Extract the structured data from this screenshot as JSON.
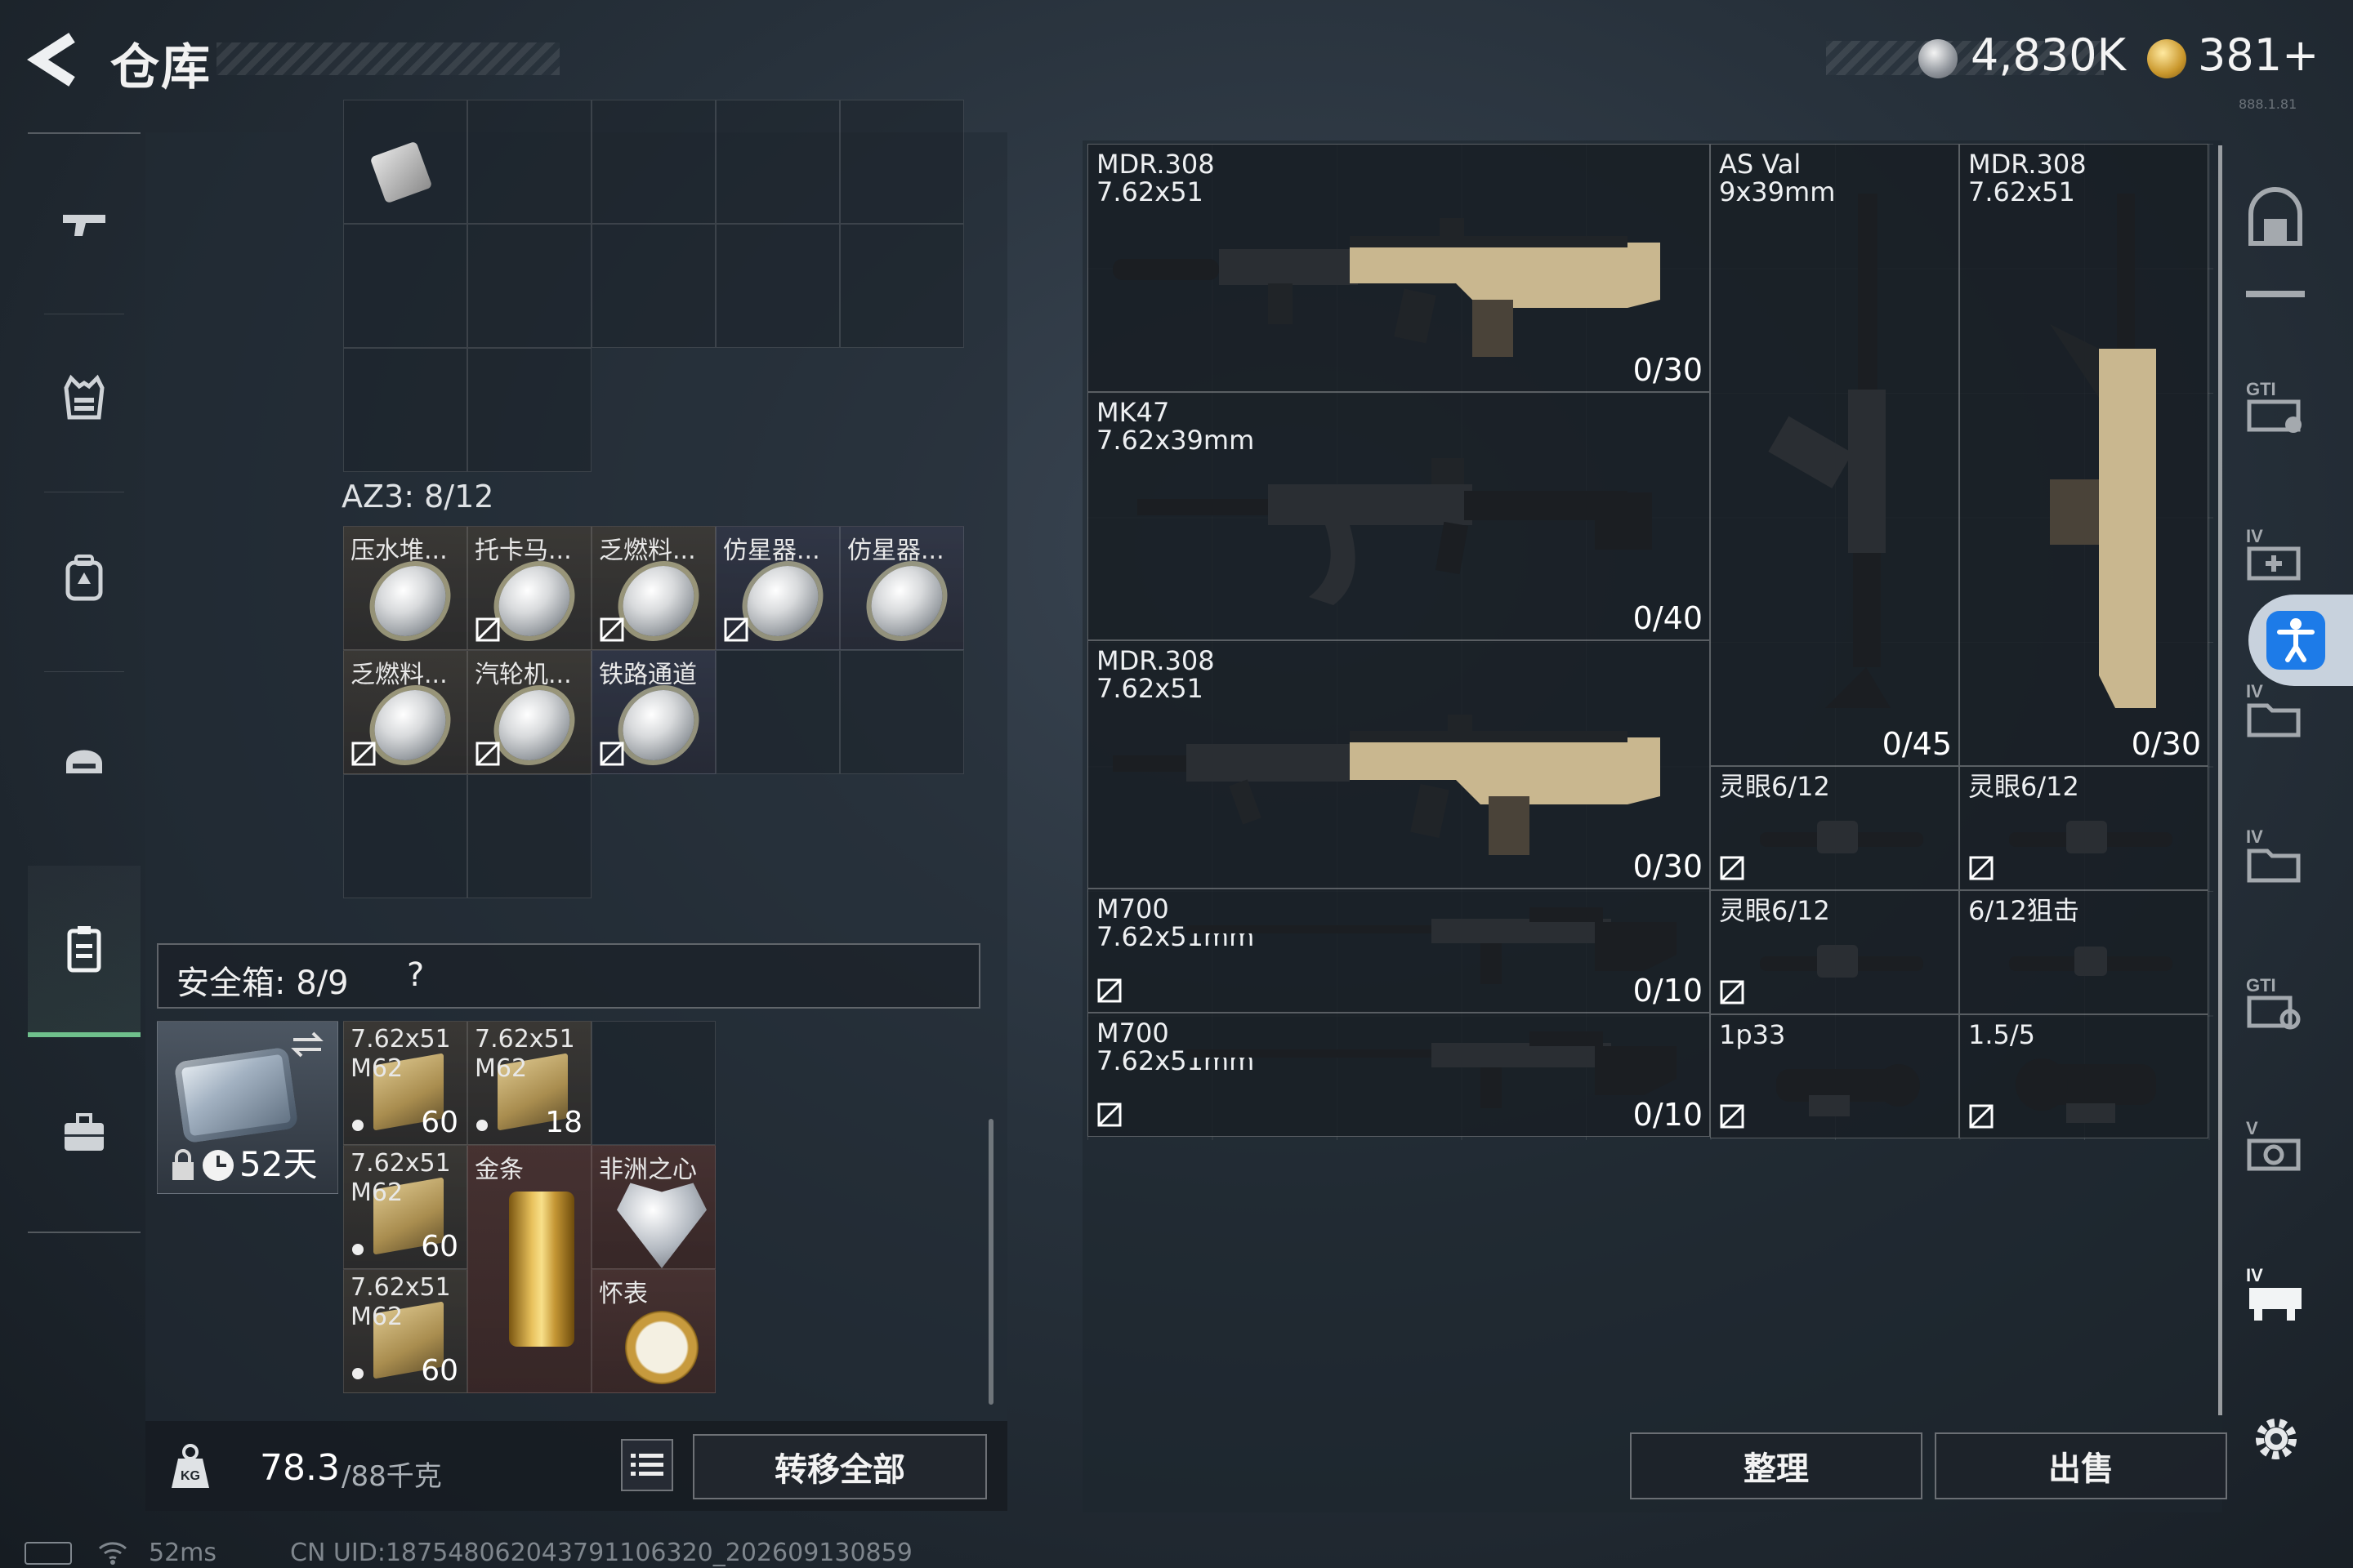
{
  "header": {
    "title": "仓库",
    "currency_silver": "4,830K",
    "currency_gold": "381+",
    "version_tag": "888.1.81"
  },
  "left_nav": {
    "items": [
      {
        "name": "weapons",
        "icon": "pistol-icon"
      },
      {
        "name": "armor",
        "icon": "vest-icon"
      },
      {
        "name": "backpack",
        "icon": "backpack-icon"
      },
      {
        "name": "helmet-gear",
        "icon": "helmet-icon"
      },
      {
        "name": "containers",
        "icon": "clipboard-icon"
      },
      {
        "name": "case",
        "icon": "briefcase-icon"
      }
    ],
    "active_index": 4
  },
  "stash": {
    "az3_label": "AZ3: 8/12",
    "az3_items": [
      {
        "name": "压水堆...",
        "no_sell": false
      },
      {
        "name": "托卡马...",
        "no_sell": true
      },
      {
        "name": "乏燃料...",
        "no_sell": true
      },
      {
        "name": "仿星器...",
        "no_sell": true
      },
      {
        "name": "仿星器...",
        "no_sell": false
      },
      {
        "name": "乏燃料...",
        "no_sell": true
      },
      {
        "name": "汽轮机...",
        "no_sell": true
      },
      {
        "name": "铁路通道",
        "no_sell": true
      }
    ],
    "safe_label": "安全箱: 8/9",
    "safe_help": "?",
    "case_days": "52天",
    "safe_items": [
      {
        "line1": "7.62x51",
        "line2": "M62",
        "count": "60"
      },
      {
        "line1": "7.62x51",
        "line2": "M62",
        "count": "18"
      },
      {
        "line1": "7.62x51",
        "line2": "M62",
        "count": "60"
      },
      {
        "line1": "金条",
        "line2": "",
        "count": ""
      },
      {
        "line1": "非洲之心",
        "line2": "",
        "count": ""
      },
      {
        "line1": "7.62x51",
        "line2": "M62",
        "count": "60"
      },
      {
        "line1": "怀表",
        "line2": "",
        "count": ""
      }
    ],
    "weight_current": "78.3",
    "weight_max": "/88千克",
    "transfer_all": "转移全部"
  },
  "weapons": [
    {
      "name": "MDR.308",
      "caliber": "7.62x51",
      "ammo": "0/30"
    },
    {
      "name": "AS Val",
      "caliber": "9x39mm",
      "ammo": "0/45"
    },
    {
      "name": "MDR.308",
      "caliber": "7.62x51",
      "ammo": "0/30"
    },
    {
      "name": "MK47",
      "caliber": "7.62x39mm",
      "ammo": "0/40"
    },
    {
      "name": "MDR.308",
      "caliber": "7.62x51",
      "ammo": "0/30"
    },
    {
      "name": "M700",
      "caliber": "7.62x51mm",
      "ammo": "0/10"
    },
    {
      "name": "M700",
      "caliber": "7.62x51mm",
      "ammo": "0/10"
    }
  ],
  "scopes": [
    {
      "name": "灵眼6/12",
      "no_sell": true
    },
    {
      "name": "灵眼6/12",
      "no_sell": true
    },
    {
      "name": "灵眼6/12",
      "no_sell": true
    },
    {
      "name": "6/12狙击",
      "no_sell": false
    },
    {
      "name": "1p33",
      "no_sell": true
    },
    {
      "name": "1.5/5",
      "no_sell": true
    }
  ],
  "actions": {
    "sort": "整理",
    "sell": "出售"
  },
  "status": {
    "ping": "52ms",
    "uid": "CN UID:18754806204379110632​0_202609130859"
  },
  "colors": {
    "accent_green": "#6fc08c",
    "accessibility_blue": "#1d7be8",
    "gold": "#c9972c"
  }
}
